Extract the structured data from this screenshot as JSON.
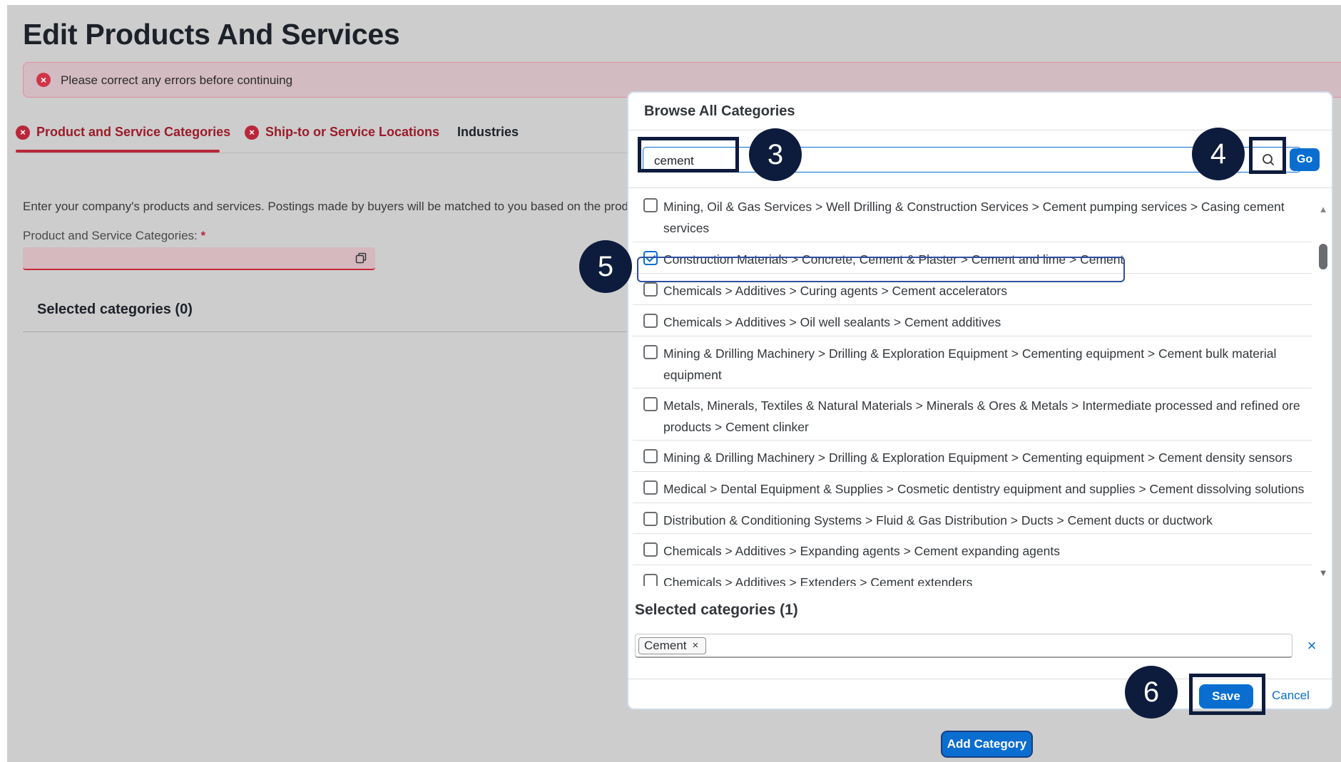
{
  "page": {
    "title": "Edit Products And Services",
    "error_icon": "x-circle-icon",
    "error_message": "Please correct any errors before continuing",
    "tabs": [
      {
        "label": "Product and Service Categories",
        "has_error": true
      },
      {
        "label": "Ship-to or Service Locations",
        "has_error": true
      },
      {
        "label": "Industries",
        "has_error": false
      }
    ],
    "intro": "Enter your company's products and services. Postings made by buyers will be matched to you based on the prod",
    "field_label": "Product and Service Categories:",
    "required_mark": "*",
    "copy_icon": "copy-icon",
    "selected_title": "Selected categories (0)",
    "add_category_label": "Add Category"
  },
  "dialog": {
    "title": "Browse All Categories",
    "search_value": "cement",
    "search_icon": "magnifier-icon",
    "go_label": "Go",
    "results": [
      {
        "label": "Mining, Oil & Gas Services > Well Drilling & Construction Services > Cement pumping services > Casing cement services",
        "checked": false
      },
      {
        "label": "Construction Materials > Concrete, Cement & Plaster > Cement and lime > Cement",
        "checked": true
      },
      {
        "label": "Chemicals > Additives > Curing agents > Cement accelerators",
        "checked": false
      },
      {
        "label": "Chemicals > Additives > Oil well sealants > Cement additives",
        "checked": false
      },
      {
        "label": "Mining & Drilling Machinery > Drilling & Exploration Equipment > Cementing equipment > Cement bulk material equipment",
        "checked": false
      },
      {
        "label": "Metals, Minerals, Textiles & Natural Materials > Minerals & Ores & Metals > Intermediate processed and refined ore products > Cement clinker",
        "checked": false
      },
      {
        "label": "Mining & Drilling Machinery > Drilling & Exploration Equipment > Cementing equipment > Cement density sensors",
        "checked": false
      },
      {
        "label": "Medical > Dental Equipment & Supplies > Cosmetic dentistry equipment and supplies > Cement dissolving solutions",
        "checked": false
      },
      {
        "label": "Distribution & Conditioning Systems > Fluid & Gas Distribution > Ducts > Cement ducts or ductwork",
        "checked": false
      },
      {
        "label": "Chemicals > Additives > Expanding agents > Cement expanding agents",
        "checked": false
      },
      {
        "label": "Chemicals > Additives > Extenders > Cement extenders",
        "checked": false
      }
    ],
    "selected_title": "Selected categories (1)",
    "selected_tokens": [
      "Cement"
    ],
    "token_remove": "×",
    "clear_all": "×",
    "save_label": "Save",
    "cancel_label": "Cancel"
  },
  "annotations": {
    "step_3": "3",
    "step_4": "4",
    "step_5": "5",
    "step_6": "6"
  },
  "colors": {
    "accent": "#0a6ed1",
    "error": "#b8283a",
    "callout": "#0d1b3d"
  }
}
